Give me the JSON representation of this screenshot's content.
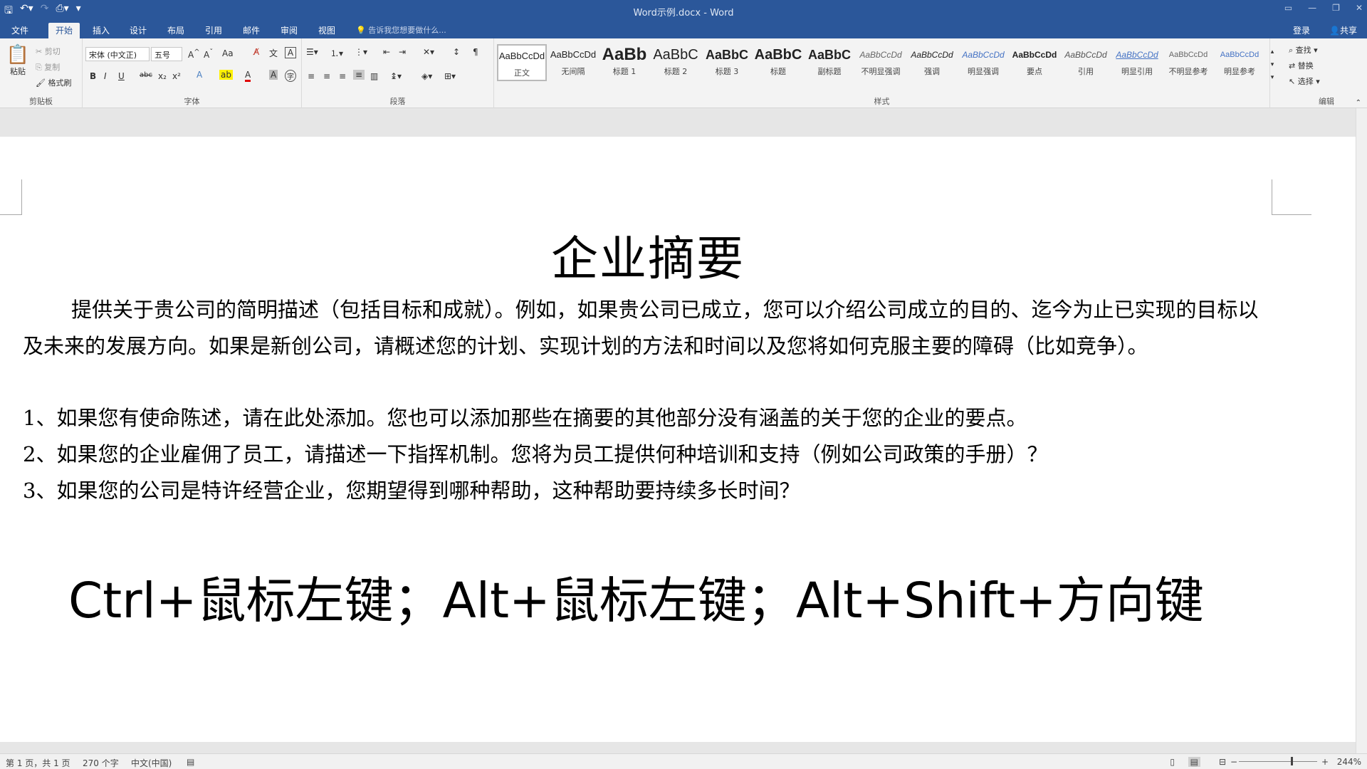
{
  "window": {
    "title": "Word示例.docx - Word",
    "qat": [
      "save",
      "undo",
      "redo",
      "print-preview",
      "customize"
    ]
  },
  "tabs": [
    {
      "label": "文件"
    },
    {
      "label": "开始"
    },
    {
      "label": "插入"
    },
    {
      "label": "设计"
    },
    {
      "label": "布局"
    },
    {
      "label": "引用"
    },
    {
      "label": "邮件"
    },
    {
      "label": "审阅"
    },
    {
      "label": "视图"
    }
  ],
  "tell_me": "告诉我您想要做什么...",
  "account": {
    "login": "登录",
    "share": "共享"
  },
  "clipboard": {
    "paste": "粘贴",
    "cut": "剪切",
    "copy": "复制",
    "format_painter": "格式刷",
    "group": "剪贴板"
  },
  "font": {
    "name": "宋体 (中文正)",
    "size": "五号",
    "bold": "B",
    "italic": "I",
    "underline": "U",
    "strike": "abc",
    "sub": "x₂",
    "sup": "x²",
    "case": "Aa",
    "group": "字体"
  },
  "paragraph": {
    "group": "段落"
  },
  "styles": {
    "group": "样式",
    "items": [
      {
        "preview": "AaBbCcDd",
        "name": "正文"
      },
      {
        "preview": "AaBbCcDd",
        "name": "无间隔"
      },
      {
        "preview": "AaBb",
        "name": "标题 1"
      },
      {
        "preview": "AaBbC",
        "name": "标题 2"
      },
      {
        "preview": "AaBbC",
        "name": "标题 3"
      },
      {
        "preview": "AaBbC",
        "name": "标题"
      },
      {
        "preview": "AaBbC",
        "name": "副标题"
      },
      {
        "preview": "AaBbCcDd",
        "name": "不明显强调"
      },
      {
        "preview": "AaBbCcDd",
        "name": "强调"
      },
      {
        "preview": "AaBbCcDd",
        "name": "明显强调"
      },
      {
        "preview": "AaBbCcDd",
        "name": "要点"
      },
      {
        "preview": "AaBbCcDd",
        "name": "引用"
      },
      {
        "preview": "AaBbCcDd",
        "name": "明显引用"
      },
      {
        "preview": "AaBbCcDd",
        "name": "不明显参考"
      },
      {
        "preview": "AaBbCcDd",
        "name": "明显参考"
      }
    ]
  },
  "editing": {
    "find": "查找",
    "replace": "替换",
    "select": "选择",
    "group": "编辑"
  },
  "document": {
    "title": "企业摘要",
    "intro": "提供关于贵公司的简明描述（包括目标和成就）。例如，如果贵公司已成立，您可以介绍公司成立的目的、迄今为止已实现的目标以及未来的发展方向。如果是新创公司，请概述您的计划、实现计划的方法和时间以及您将如何克服主要的障碍（比如竞争）。",
    "items": [
      "1、如果您有使命陈述，请在此处添加。您也可以添加那些在摘要的其他部分没有涵盖的关于您的企业的要点。",
      "2、如果您的企业雇佣了员工，请描述一下指挥机制。您将为员工提供何种培训和支持（例如公司政策的手册）？",
      "3、如果您的公司是特许经营企业，您期望得到哪种帮助，这种帮助要持续多长时间？"
    ],
    "shortcut": "Ctrl+鼠标左键；Alt+鼠标左键；Alt+Shift+方向键"
  },
  "status": {
    "page": "第 1 页，共 1 页",
    "words": "270 个字",
    "lang": "中文(中国)",
    "zoom": "244%"
  }
}
